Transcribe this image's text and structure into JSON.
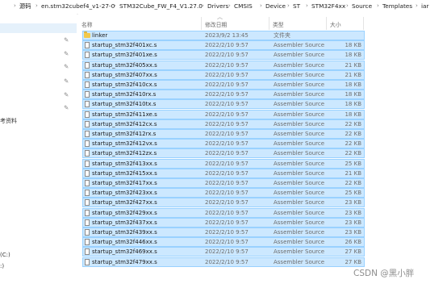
{
  "breadcrumb": [
    "源码",
    "en.stm32cubef4_v1-27-0",
    "STM32Cube_FW_F4_V1.27.0",
    "Drivers",
    "CMSIS",
    "Device",
    "ST",
    "STM32F4xx",
    "Source",
    "Templates",
    "iar"
  ],
  "columns": {
    "name": "名称",
    "date": "修改日期",
    "type": "类型",
    "size": "大小"
  },
  "nav": {
    "label_reference": "考资料",
    "label_drive_c": "(C:)",
    "label_drive_d": ":)"
  },
  "files": [
    {
      "name": "linker",
      "date": "2023/9/2 13:45",
      "type": "文件夹",
      "size": "",
      "folder": true
    },
    {
      "name": "startup_stm32f401xc.s",
      "date": "2022/2/10 9:57",
      "type": "Assembler Source",
      "size": "18 KB"
    },
    {
      "name": "startup_stm32f401xe.s",
      "date": "2022/2/10 9:57",
      "type": "Assembler Source",
      "size": "18 KB"
    },
    {
      "name": "startup_stm32f405xx.s",
      "date": "2022/2/10 9:57",
      "type": "Assembler Source",
      "size": "21 KB"
    },
    {
      "name": "startup_stm32f407xx.s",
      "date": "2022/2/10 9:57",
      "type": "Assembler Source",
      "size": "21 KB"
    },
    {
      "name": "startup_stm32f410cx.s",
      "date": "2022/2/10 9:57",
      "type": "Assembler Source",
      "size": "18 KB"
    },
    {
      "name": "startup_stm32f410rx.s",
      "date": "2022/2/10 9:57",
      "type": "Assembler Source",
      "size": "18 KB"
    },
    {
      "name": "startup_stm32f410tx.s",
      "date": "2022/2/10 9:57",
      "type": "Assembler Source",
      "size": "18 KB"
    },
    {
      "name": "startup_stm32f411xe.s",
      "date": "2022/2/10 9:57",
      "type": "Assembler Source",
      "size": "18 KB"
    },
    {
      "name": "startup_stm32f412cx.s",
      "date": "2022/2/10 9:57",
      "type": "Assembler Source",
      "size": "22 KB"
    },
    {
      "name": "startup_stm32f412rx.s",
      "date": "2022/2/10 9:57",
      "type": "Assembler Source",
      "size": "22 KB"
    },
    {
      "name": "startup_stm32f412vx.s",
      "date": "2022/2/10 9:57",
      "type": "Assembler Source",
      "size": "22 KB"
    },
    {
      "name": "startup_stm32f412zx.s",
      "date": "2022/2/10 9:57",
      "type": "Assembler Source",
      "size": "22 KB"
    },
    {
      "name": "startup_stm32f413xx.s",
      "date": "2022/2/10 9:57",
      "type": "Assembler Source",
      "size": "25 KB"
    },
    {
      "name": "startup_stm32f415xx.s",
      "date": "2022/2/10 9:57",
      "type": "Assembler Source",
      "size": "21 KB"
    },
    {
      "name": "startup_stm32f417xx.s",
      "date": "2022/2/10 9:57",
      "type": "Assembler Source",
      "size": "22 KB"
    },
    {
      "name": "startup_stm32f423xx.s",
      "date": "2022/2/10 9:57",
      "type": "Assembler Source",
      "size": "25 KB"
    },
    {
      "name": "startup_stm32f427xx.s",
      "date": "2022/2/10 9:57",
      "type": "Assembler Source",
      "size": "23 KB"
    },
    {
      "name": "startup_stm32f429xx.s",
      "date": "2022/2/10 9:57",
      "type": "Assembler Source",
      "size": "23 KB"
    },
    {
      "name": "startup_stm32f437xx.s",
      "date": "2022/2/10 9:57",
      "type": "Assembler Source",
      "size": "23 KB"
    },
    {
      "name": "startup_stm32f439xx.s",
      "date": "2022/2/10 9:57",
      "type": "Assembler Source",
      "size": "23 KB"
    },
    {
      "name": "startup_stm32f446xx.s",
      "date": "2022/2/10 9:57",
      "type": "Assembler Source",
      "size": "26 KB"
    },
    {
      "name": "startup_stm32f469xx.s",
      "date": "2022/2/10 9:57",
      "type": "Assembler Source",
      "size": "27 KB"
    },
    {
      "name": "startup_stm32f479xx.s",
      "date": "2022/2/10 9:57",
      "type": "Assembler Source",
      "size": "27 KB"
    }
  ],
  "watermark": "CSDN @黑小胖",
  "colors": {
    "selection_bg": "#cce8ff",
    "selection_border": "#99d1ff",
    "folder": "#f2c94c"
  },
  "icons": {
    "folder": "folder-icon",
    "file": "file-icon",
    "pin": "pin-icon",
    "breadcrumb_separator": "chevron-right-icon",
    "sort": "sort-up-icon"
  }
}
